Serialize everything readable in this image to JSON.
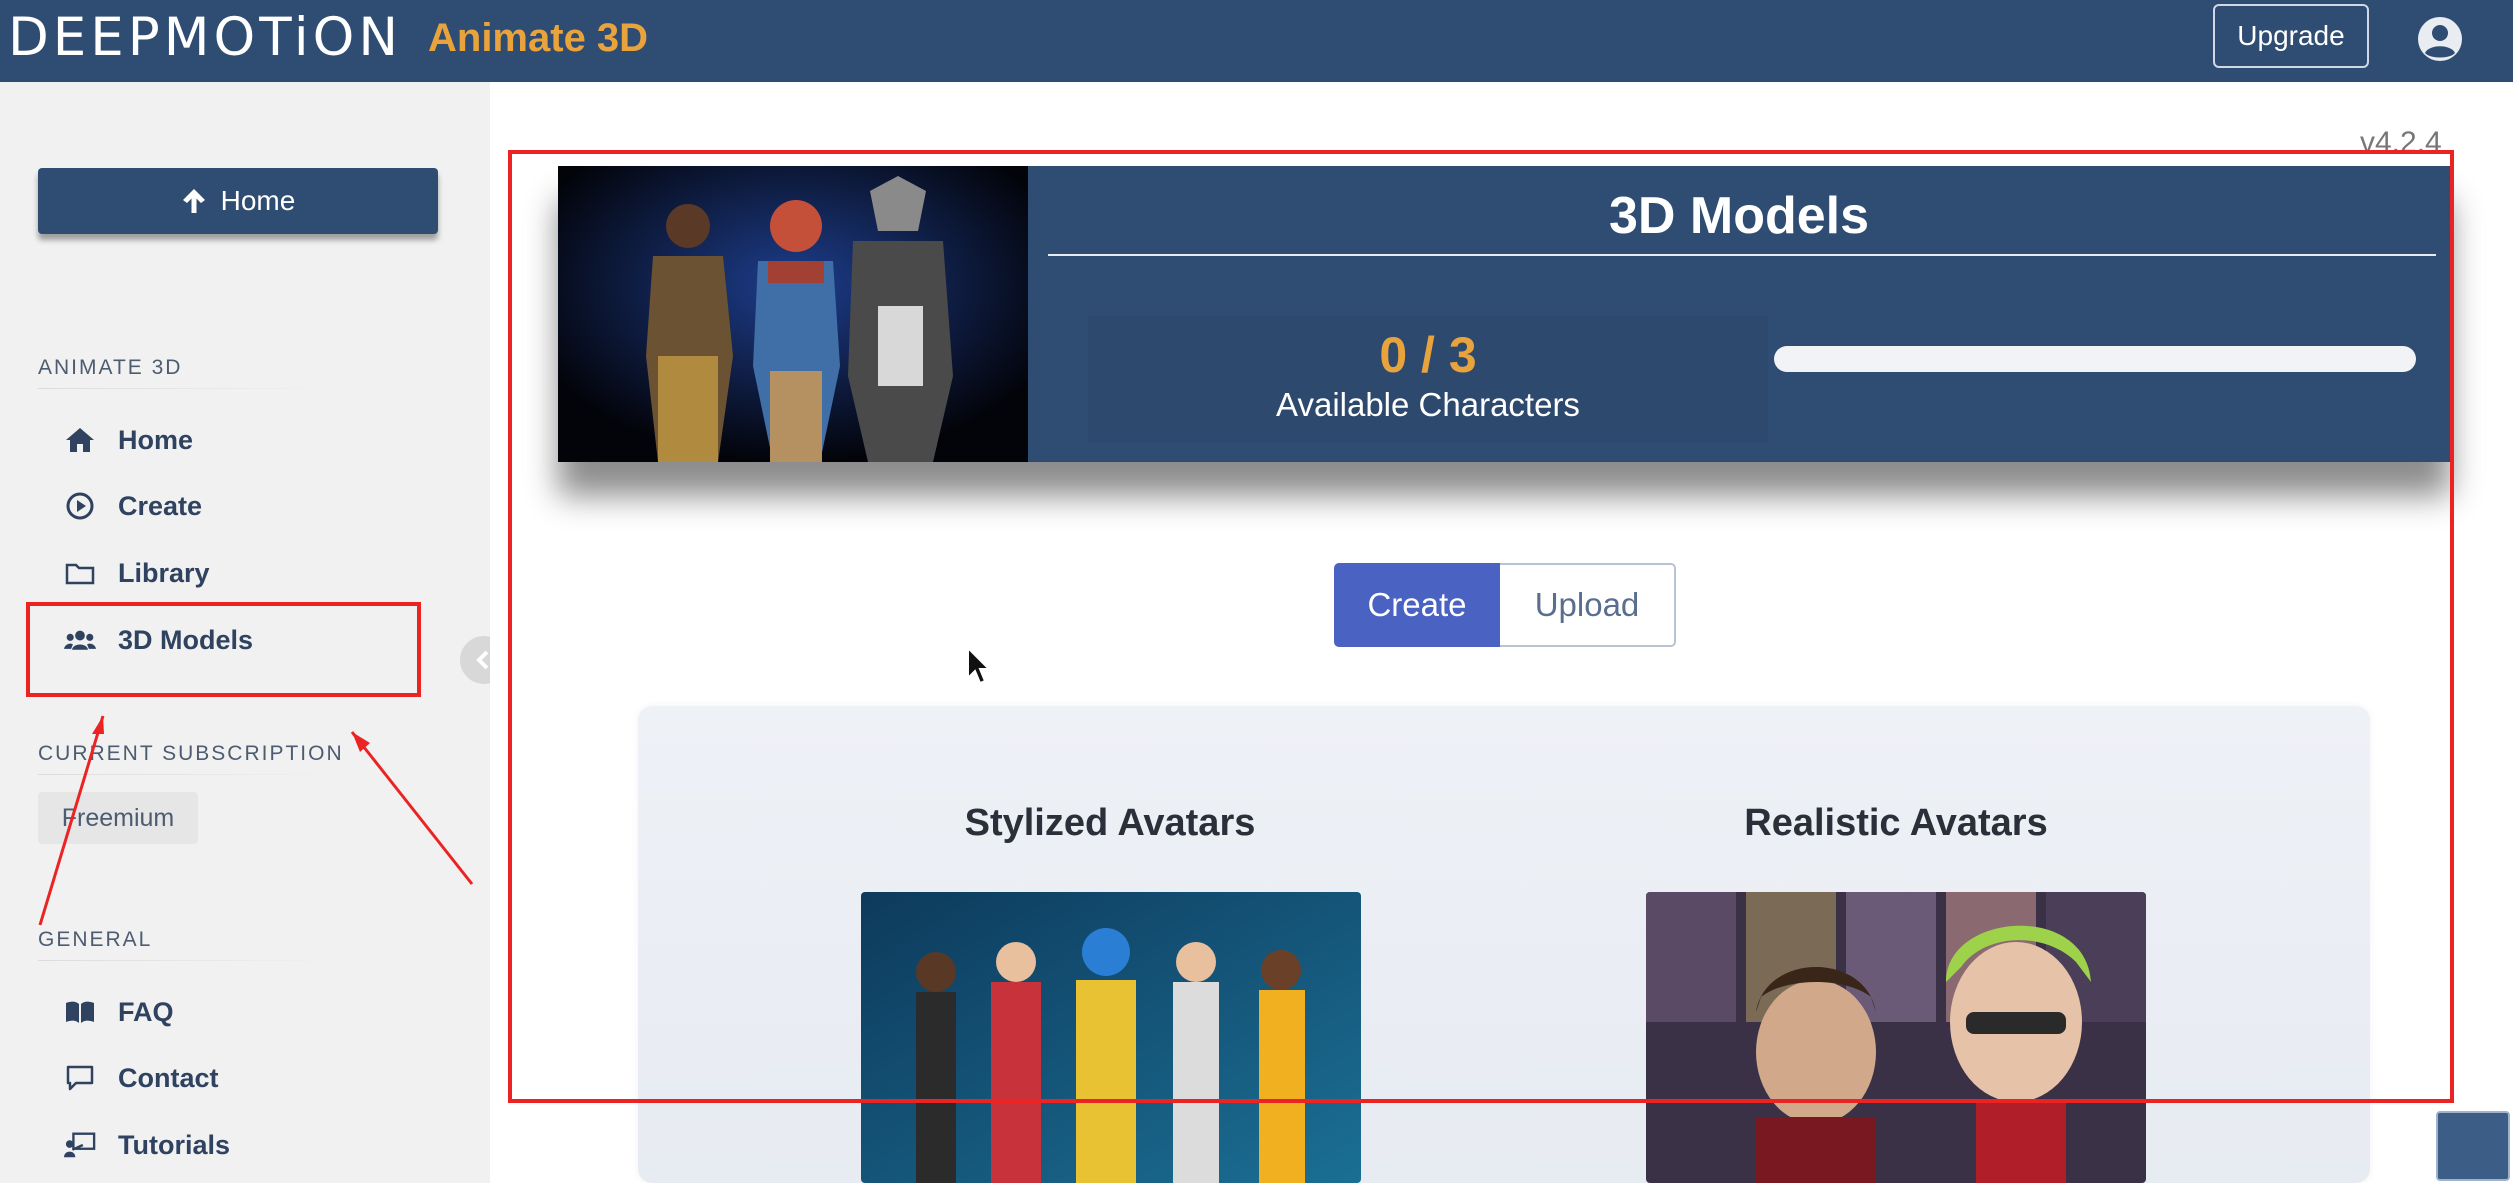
{
  "header": {
    "brand": "DEEPMOTiON",
    "app_name": "Animate 3D",
    "upgrade_label": "Upgrade",
    "user_icon": "user-circle-icon"
  },
  "sidebar": {
    "home_button_label": "Home",
    "sections": {
      "animate": "ANIMATE 3D",
      "subscription": "CURRENT SUBSCRIPTION",
      "general": "GENERAL"
    },
    "animate_items": [
      {
        "label": "Home",
        "icon": "house-icon"
      },
      {
        "label": "Create",
        "icon": "play-circle-icon"
      },
      {
        "label": "Library",
        "icon": "folder-icon"
      },
      {
        "label": "3D Models",
        "icon": "users-icon"
      }
    ],
    "subscription_plan": "Freemium",
    "general_items": [
      {
        "label": "FAQ",
        "icon": "book-icon"
      },
      {
        "label": "Contact",
        "icon": "chat-icon"
      },
      {
        "label": "Tutorials",
        "icon": "presenter-icon"
      }
    ]
  },
  "main": {
    "version": "v4.2.4",
    "banner": {
      "title": "3D Models",
      "count": "0 / 3",
      "count_label": "Available Characters",
      "usage_fraction": 0.0
    },
    "mode_toggle": {
      "create_label": "Create",
      "upload_label": "Upload",
      "selected": "Create"
    },
    "cards": [
      {
        "title": "Stylized Avatars"
      },
      {
        "title": "Realistic Avatars"
      }
    ]
  },
  "colors": {
    "header_bg": "#2f4d72",
    "accent_orange": "#e8a33c",
    "button_blue": "#4a62c1",
    "annotation_red": "#ec2323"
  }
}
